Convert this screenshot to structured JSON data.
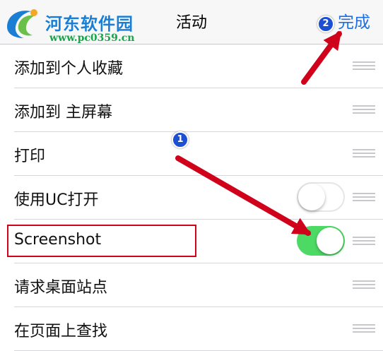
{
  "navbar": {
    "title": "活动",
    "done_label": "完成"
  },
  "watermark": {
    "title": "河东软件园",
    "url": "www.pc0359.cn"
  },
  "rows": [
    {
      "label": "添加到个人收藏"
    },
    {
      "label": "添加到 主屏幕"
    },
    {
      "label": "打印"
    },
    {
      "label": "使用UC打开",
      "toggle": "off"
    },
    {
      "label": "Screenshot",
      "toggle": "on"
    },
    {
      "label": "请求桌面站点"
    },
    {
      "label": "在页面上查找"
    }
  ],
  "annotations": {
    "step1": "1",
    "step2": "2"
  },
  "colors": {
    "accent_blue": "#1e6fe0",
    "toggle_on": "#4cd964",
    "annotation_red": "#d0021b",
    "badge_blue": "#1c4fd1"
  }
}
